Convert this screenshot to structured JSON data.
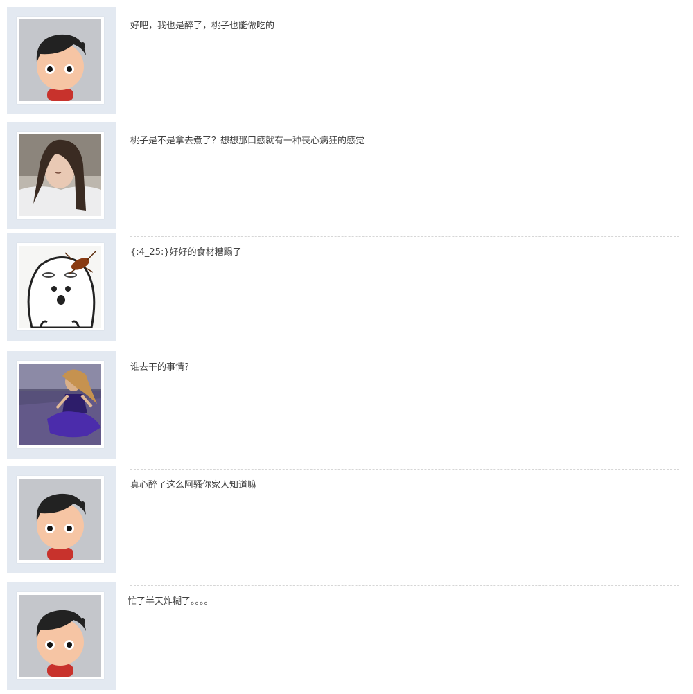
{
  "comments": [
    {
      "text": "好吧，我也是醉了，桃子也能做吃的",
      "avatar": "cartoon-boy-avatar"
    },
    {
      "text": "桃子是不是拿去煮了？想想那口感就有一种丧心病狂的感觉",
      "avatar": "girl-photo-avatar"
    },
    {
      "text": "{:4_25:}好好的食材糟蹋了",
      "avatar": "meme-face-avatar"
    },
    {
      "text": "谁去干的事情？",
      "avatar": "girl-lavender-field-avatar"
    },
    {
      "text": "真心醉了这么阿骚你家人知道嘛",
      "avatar": "cartoon-boy-avatar"
    },
    {
      "text": "忙了半天炸糊了。。。。",
      "avatar": "cartoon-boy-avatar"
    }
  ]
}
